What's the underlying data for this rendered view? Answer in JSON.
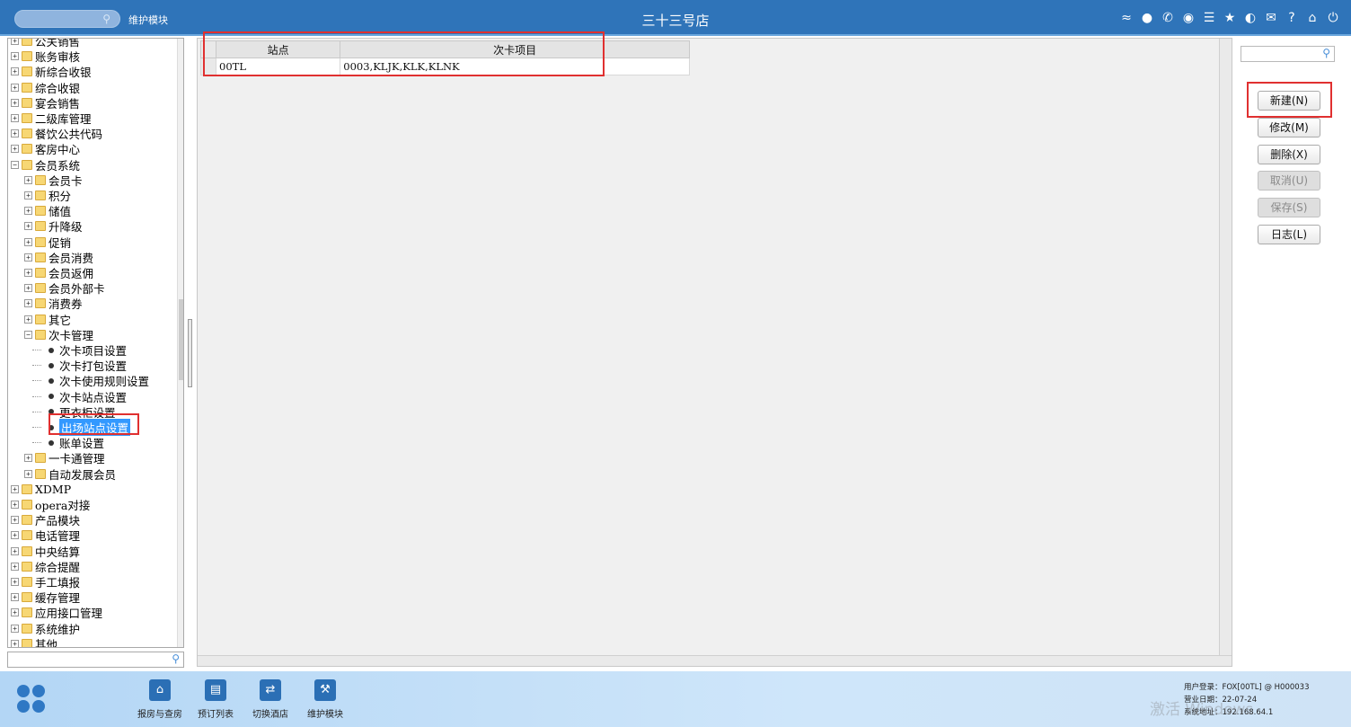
{
  "topbar": {
    "search_placeholder": "",
    "module_label": "维护模块",
    "title": "三十三号店",
    "icons": [
      "wifi-icon",
      "chat-icon",
      "phone-icon",
      "palette-icon",
      "menu-icon",
      "star-icon",
      "moon-icon",
      "mail-icon",
      "help-icon",
      "home-icon",
      "power-icon"
    ]
  },
  "tree": {
    "top_nodes_a": [
      "公关销售",
      "账务审核",
      "新综合收银",
      "综合收银",
      "宴会销售",
      "二级库管理",
      "餐饮公共代码",
      "客房中心",
      "会员系统"
    ],
    "member_children": [
      "会员卡",
      "积分",
      "储值",
      "升降级",
      "促销",
      "会员消费",
      "会员返佣",
      "会员外部卡",
      "消费券",
      "其它",
      "次卡管理"
    ],
    "card_children": [
      "次卡项目设置",
      "次卡打包设置",
      "次卡使用规则设置",
      "次卡站点设置",
      "更衣柜设置",
      "出场站点设置",
      "账单设置"
    ],
    "member_children_b": [
      "一卡通管理",
      "自动发展会员"
    ],
    "top_nodes_b": [
      "XDMP",
      "opera对接",
      "产品模块",
      "电话管理",
      "中央结算",
      "综合提醒",
      "手工填报",
      "缓存管理",
      "应用接口管理",
      "系统维护",
      "其他"
    ],
    "selected": "出场站点设置"
  },
  "grid": {
    "columns": [
      "站点",
      "次卡项目"
    ],
    "rows": [
      {
        "site": "00TL",
        "items": "0003,KLJK,KLK,KLNK"
      }
    ]
  },
  "right_panel": {
    "search_placeholder": "",
    "buttons": [
      {
        "label": "新建(N)",
        "enabled": true
      },
      {
        "label": "修改(M)",
        "enabled": true
      },
      {
        "label": "删除(X)",
        "enabled": true
      },
      {
        "label": "取消(U)",
        "enabled": false
      },
      {
        "label": "保存(S)",
        "enabled": false
      },
      {
        "label": "日志(L)",
        "enabled": true
      }
    ]
  },
  "bottombar": {
    "buttons": [
      "报房与查房",
      "预订列表",
      "切换酒店",
      "维护模块"
    ],
    "user_login_label": "用户登录：",
    "user_login": "FOX[00TL] @ H000033",
    "biz_date_label": "营业日期：",
    "biz_date": "22-07-24",
    "sys_addr_label": "系统地址：",
    "sys_addr": "192.168.64.1",
    "watermark": "激活 Windows"
  },
  "colors": {
    "topbar": "#2f74b9",
    "selection": "#3399ff",
    "highlight": "#e03030"
  }
}
